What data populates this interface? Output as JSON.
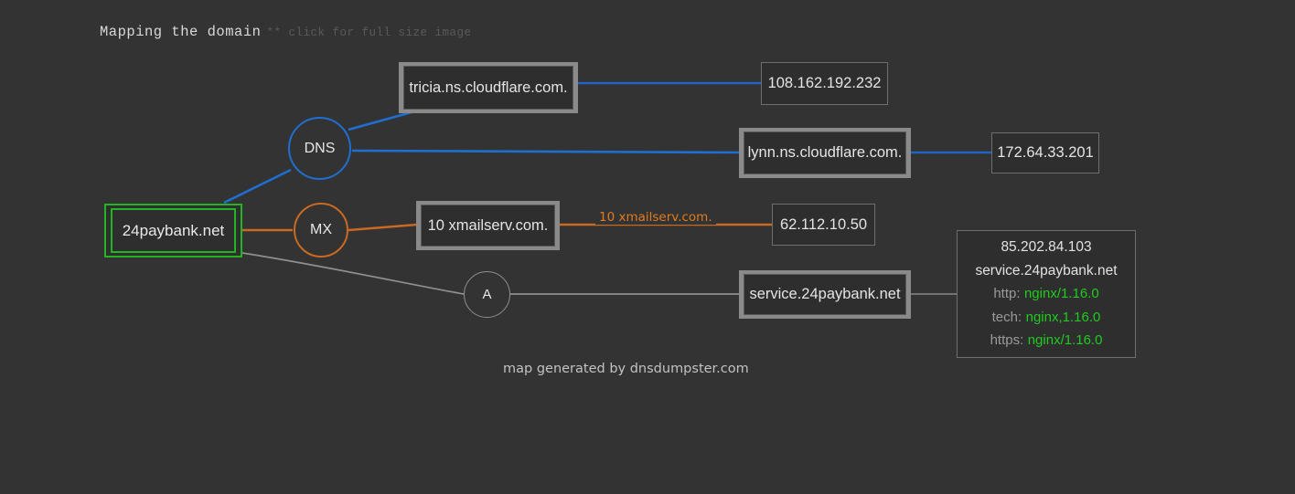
{
  "header": {
    "title": "Mapping the domain",
    "hint": "** click for full size image"
  },
  "colors": {
    "background": "#333333",
    "dns_edge": "#1f6fd0",
    "mx_edge": "#c96a22",
    "a_edge": "#8f8f8f",
    "root_border": "#22b422",
    "service_value": "#1ecb1e",
    "box_border": "#8a8a8a"
  },
  "graph": {
    "root": {
      "label": "24paybank.net"
    },
    "types": {
      "dns": "DNS",
      "mx": "MX",
      "a": "A"
    },
    "dns_records": [
      {
        "host": "tricia.ns.cloudflare.com.",
        "ip": "108.162.192.232"
      },
      {
        "host": "lynn.ns.cloudflare.com.",
        "ip": "172.64.33.201"
      }
    ],
    "mx_records": [
      {
        "host": "10 xmailserv.com.",
        "edge_label": "10 xmailserv.com.",
        "ip": "62.112.10.50"
      }
    ],
    "a_records": [
      {
        "host": "service.24paybank.net"
      }
    ]
  },
  "info_panel": {
    "ip": "85.202.84.103",
    "hostname": "service.24paybank.net",
    "rows": [
      {
        "key": "http:",
        "value": "nginx/1.16.0"
      },
      {
        "key": "tech:",
        "value": "nginx,1.16.0"
      },
      {
        "key": "https:",
        "value": "nginx/1.16.0"
      }
    ]
  },
  "footer": {
    "text": "map generated by dnsdumpster.com"
  }
}
